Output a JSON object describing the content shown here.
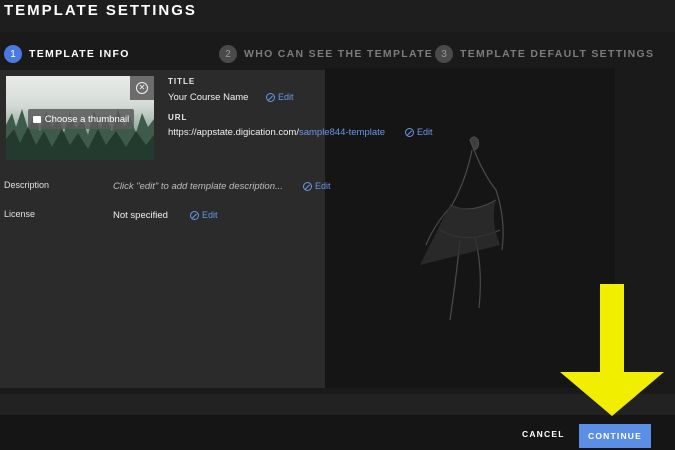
{
  "header": {
    "title": "TEMPLATE SETTINGS"
  },
  "steps": [
    {
      "num": "1",
      "label": "TEMPLATE INFO",
      "active": true
    },
    {
      "num": "2",
      "label": "WHO CAN SEE THE TEMPLATE",
      "active": false
    },
    {
      "num": "3",
      "label": "TEMPLATE DEFAULT SETTINGS",
      "active": false
    }
  ],
  "thumbnail": {
    "button_label": "Choose a thumbnail",
    "icon": "image-icon",
    "remove_icon": "close-circle-icon"
  },
  "title_field": {
    "label": "TITLE",
    "value": "Your Course Name",
    "edit": "Edit"
  },
  "url_field": {
    "label": "URL",
    "value_prefix": "https://appstate.digication.com/",
    "value_slug": "sample844-template",
    "edit": "Edit"
  },
  "description": {
    "label": "Description",
    "placeholder": "Click \"edit\" to add template description...",
    "edit": "Edit"
  },
  "license": {
    "label": "License",
    "value": "Not specified",
    "edit": "Edit"
  },
  "footer": {
    "cancel": "CANCEL",
    "continue": "CONTINUE"
  },
  "colors": {
    "accent": "#5b8fe6",
    "link": "#6a98e8",
    "arrow": "#f2ee00",
    "background": "#1c1c1c"
  }
}
